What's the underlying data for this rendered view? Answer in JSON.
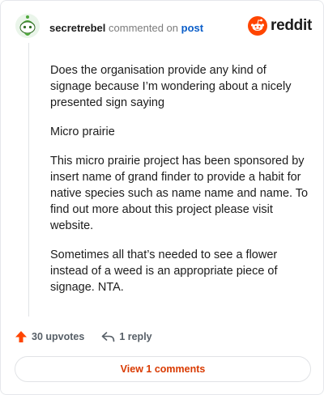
{
  "header": {
    "username": "secretrebel",
    "action_text": "commented on",
    "post_link": "post",
    "brand_name": "reddit"
  },
  "comment": {
    "paragraphs": [
      "Does the organisation provide any kind of signage because I’m wondering about a nicely presented sign saying",
      "Micro prairie",
      "This micro prairie project has been sponsored by insert name of grand finder to provide a habit for native species such as name name and name. To find out more about this project please visit website.",
      "Sometimes all that’s needed to see a flower instead of a weed is an appropriate piece of signage. NTA."
    ]
  },
  "actions": {
    "upvotes_label": "30 upvotes",
    "reply_label": "1 reply"
  },
  "footer": {
    "view_comments_label": "View 1 comments"
  },
  "colors": {
    "brand_orange": "#ff4500",
    "link_blue": "#0b5ec9",
    "view_button_text": "#d93a00"
  },
  "icons": {
    "upvote": "upvote-arrow-icon",
    "reply": "reply-arrow-icon",
    "brand": "reddit-snoo-icon",
    "avatar": "snoo-avatar"
  }
}
